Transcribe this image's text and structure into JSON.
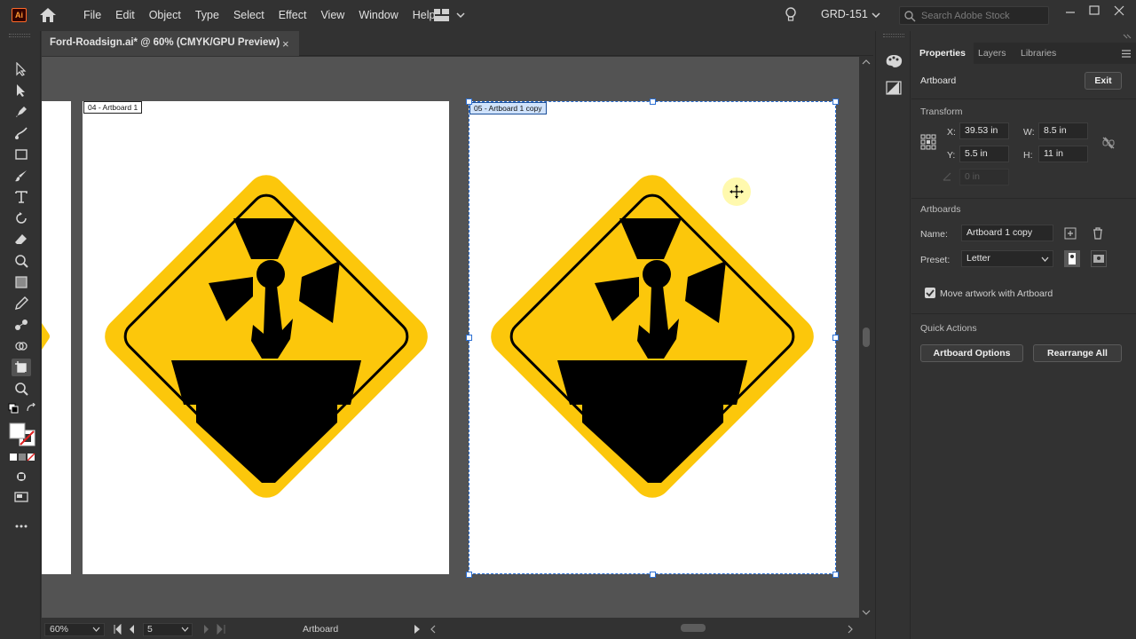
{
  "app": {
    "logo_text": "Ai",
    "menu": [
      "File",
      "Edit",
      "Object",
      "Type",
      "Select",
      "Effect",
      "View",
      "Window",
      "Help"
    ],
    "workspace_name": "GRD-151",
    "stock_search_placeholder": "Search Adobe Stock"
  },
  "document": {
    "tab_title": "Ford-Roadsign.ai* @ 60% (CMYK/GPU Preview)",
    "close_glyph": "×"
  },
  "canvas": {
    "artboards": [
      {
        "label": "04 - Artboard 1"
      },
      {
        "label": "05 - Artboard 1 copy"
      }
    ]
  },
  "status_bar": {
    "zoom": "60%",
    "artboard_number": "5",
    "mode_text": "Artboard"
  },
  "properties": {
    "tabs": [
      "Properties",
      "Layers",
      "Libraries"
    ],
    "object_type": "Artboard",
    "exit_label": "Exit",
    "transform": {
      "title": "Transform",
      "x_label": "X:",
      "x_value": "39.53 in",
      "y_label": "Y:",
      "y_value": "5.5 in",
      "w_label": "W:",
      "w_value": "8.5 in",
      "h_label": "H:",
      "h_value": "11 in",
      "angle_value": "0 in"
    },
    "artboards": {
      "title": "Artboards",
      "name_label": "Name:",
      "name_value": "Artboard 1 copy",
      "preset_label": "Preset:",
      "preset_value": "Letter",
      "move_artwork_label": "Move artwork with Artboard"
    },
    "quick_actions": {
      "title": "Quick Actions",
      "artboard_options": "Artboard Options",
      "rearrange_all": "Rearrange All"
    }
  },
  "colors": {
    "sign_yellow": "#fcc70b",
    "selection_blue": "#2b6fd4",
    "canvas_gray": "#535353",
    "ui_dark": "#323232"
  }
}
